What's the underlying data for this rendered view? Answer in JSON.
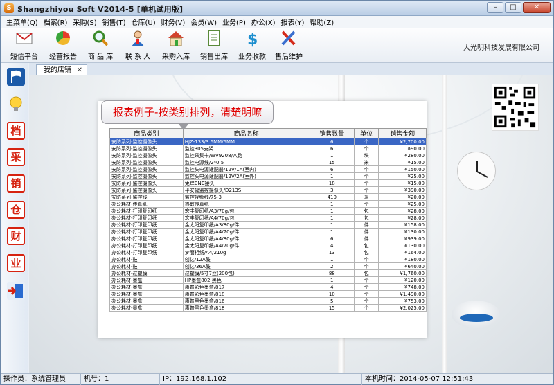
{
  "window": {
    "title": "Shangzhiyou Soft V2014-5 [单机试用版]",
    "controls": {
      "minimize": "–",
      "maximize": "□",
      "close": "✕"
    }
  },
  "menu": [
    "主菜单(Q)",
    "档案(R)",
    "采购(S)",
    "销售(T)",
    "仓库(U)",
    "财务(V)",
    "会员(W)",
    "业务(P)",
    "办公(X)",
    "报表(Y)",
    "帮助(Z)"
  ],
  "toolbar": {
    "buttons": [
      {
        "label": "短信平台",
        "icon": "mail-icon"
      },
      {
        "label": "经营报告",
        "icon": "pie-chart-icon"
      },
      {
        "label": "商 品 库",
        "icon": "magnifier-icon"
      },
      {
        "label": "联 系 人",
        "icon": "contact-person-icon"
      },
      {
        "label": "采购入库",
        "icon": "house-icon"
      },
      {
        "label": "销售出库",
        "icon": "document-icon"
      },
      {
        "label": "业务收款",
        "icon": "dollar-icon"
      },
      {
        "label": "售后维护",
        "icon": "tools-icon"
      }
    ],
    "company": "大光明科技发展有限公司"
  },
  "sidebar": [
    {
      "icon": "flag-icon",
      "char": ""
    },
    {
      "icon": "lightbulb-icon",
      "char": ""
    },
    {
      "icon": "dang-char-icon",
      "char": "档"
    },
    {
      "icon": "cai-char-icon",
      "char": "采"
    },
    {
      "icon": "xiao-char-icon",
      "char": "销"
    },
    {
      "icon": "cang-char-icon",
      "char": "仓"
    },
    {
      "icon": "cai-finance-char-icon",
      "char": "财"
    },
    {
      "icon": "ye-char-icon",
      "char": "业"
    },
    {
      "icon": "exit-door-icon",
      "char": ""
    }
  ],
  "tab": {
    "label": "我的店铺",
    "close": "✕"
  },
  "report": {
    "callout": "报表例子-按类别排列，清楚明暸",
    "columns": [
      "商品类别",
      "商品名称",
      "销售数量",
      "单位",
      "销售金额"
    ],
    "rows": [
      [
        "安防系列-监控摄像头",
        "HJZ-133/3.6MM/6MM",
        "6",
        "个",
        "¥2,700.00"
      ],
      [
        "安防系列-监控摄像头",
        "监控305支架",
        "6",
        "个",
        "¥90.00"
      ],
      [
        "安防系列-监控摄像头",
        "监控采集卡/WV9208/八路",
        "1",
        "块",
        "¥280.00"
      ],
      [
        "安防系列-监控摄像头",
        "监控电源线/2*0.5",
        "15",
        "米",
        "¥15.00"
      ],
      [
        "安防系列-监控摄像头",
        "监控头电源适配器/12V/1A(室内)",
        "6",
        "个",
        "¥150.00"
      ],
      [
        "安防系列-监控摄像头",
        "监控头电源适配器/12V/2A(室外)",
        "1",
        "个",
        "¥25.00"
      ],
      [
        "安防系列-监控摄像头",
        "免焊BNC接头",
        "18",
        "个",
        "¥15.00"
      ],
      [
        "安防系列-监控摄像头",
        "平安福监控摄像头/D213S",
        "3",
        "个",
        "¥390.00"
      ],
      [
        "安防系列-监控线",
        "监控视频线/75-3",
        "410",
        "米",
        "¥20.00"
      ],
      [
        "办公耗材-传真纸",
        "热敏传真纸",
        "1",
        "个",
        "¥25.00"
      ],
      [
        "办公耗材-打印复印纸",
        "宏丰复印纸/A3/70g/包",
        "1",
        "包",
        "¥28.00"
      ],
      [
        "办公耗材-打印复印纸",
        "宏丰复印纸/A4/70g/包",
        "1",
        "包",
        "¥28.00"
      ],
      [
        "办公耗材-打印复印纸",
        "金太阳复印纸/A3/80g/件",
        "1",
        "件",
        "¥158.00"
      ],
      [
        "办公耗材-打印复印纸",
        "金太阳复印纸/A4/70g/件",
        "1",
        "件",
        "¥130.00"
      ],
      [
        "办公耗材-打印复印纸",
        "金太阳复印纸/A4/80g/件",
        "6",
        "件",
        "¥939.00"
      ],
      [
        "办公耗材-打印复印纸",
        "金太阳复印纸/A4/70g/件",
        "4",
        "包",
        "¥130.00"
      ],
      [
        "办公耗材-打印复印纸",
        "梦丽相纸/A4/210g",
        "13",
        "包",
        "¥164.00"
      ],
      [
        "办公耗材-鼓",
        "创亿/12A鼓",
        "1",
        "个",
        "¥180.00"
      ],
      [
        "办公耗材-鼓",
        "创亿/36A鼓",
        "2",
        "个",
        "¥640.00"
      ],
      [
        "办公耗材-过塑膜",
        "过塑膜/5寸7丝(200包)",
        "88",
        "包",
        "¥1,760.00"
      ],
      [
        "办公耗材-墨盒",
        "HP墨盒802 黑色",
        "1",
        "个",
        "¥120.00"
      ],
      [
        "办公耗材-墨盒",
        "惠普彩色墨盒/817",
        "4",
        "个",
        "¥748.00"
      ],
      [
        "办公耗材-墨盒",
        "惠普彩色墨盒/818",
        "10",
        "个",
        "¥1,490.00"
      ],
      [
        "办公耗材-墨盒",
        "惠普黑色墨盒/816",
        "5",
        "个",
        "¥753.00"
      ],
      [
        "办公耗材-墨盒",
        "惠普黑色墨盒/818",
        "15",
        "个",
        "¥2,025.00"
      ]
    ]
  },
  "statusbar": {
    "operator": "操作员：系统管理员",
    "machine": "机号：1",
    "ip": "IP：192.168.1.102",
    "time": "本机时间：2014-05-07 12:51:43"
  }
}
